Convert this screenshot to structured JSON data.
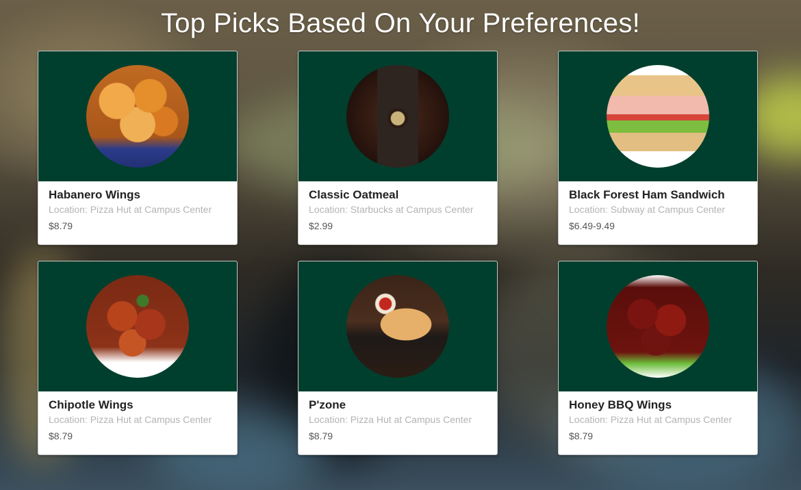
{
  "page": {
    "title": "Top Picks Based On Your Preferences!"
  },
  "colors": {
    "card_header": "#003f2d",
    "title_text": "#ffffff",
    "location_text": "#b3b3b3"
  },
  "items": [
    {
      "name": "Habanero Wings",
      "location": "Location: Pizza Hut at Campus Center",
      "price": "$8.79",
      "image": "habanero-wings-image"
    },
    {
      "name": "Classic Oatmeal",
      "location": "Location: Starbucks at Campus Center",
      "price": "$2.99",
      "image": "classic-oatmeal-image"
    },
    {
      "name": "Black Forest Ham Sandwich",
      "location": "Location: Subway at Campus Center",
      "price": "$6.49-9.49",
      "image": "ham-sandwich-image"
    },
    {
      "name": "Chipotle Wings",
      "location": "Location: Pizza Hut at Campus Center",
      "price": "$8.79",
      "image": "chipotle-wings-image"
    },
    {
      "name": "P'zone",
      "location": "Location: Pizza Hut at Campus Center",
      "price": "$8.79",
      "image": "pzone-image"
    },
    {
      "name": "Honey BBQ Wings",
      "location": "Location: Pizza Hut at Campus Center",
      "price": "$8.79",
      "image": "honey-bbq-wings-image"
    }
  ]
}
